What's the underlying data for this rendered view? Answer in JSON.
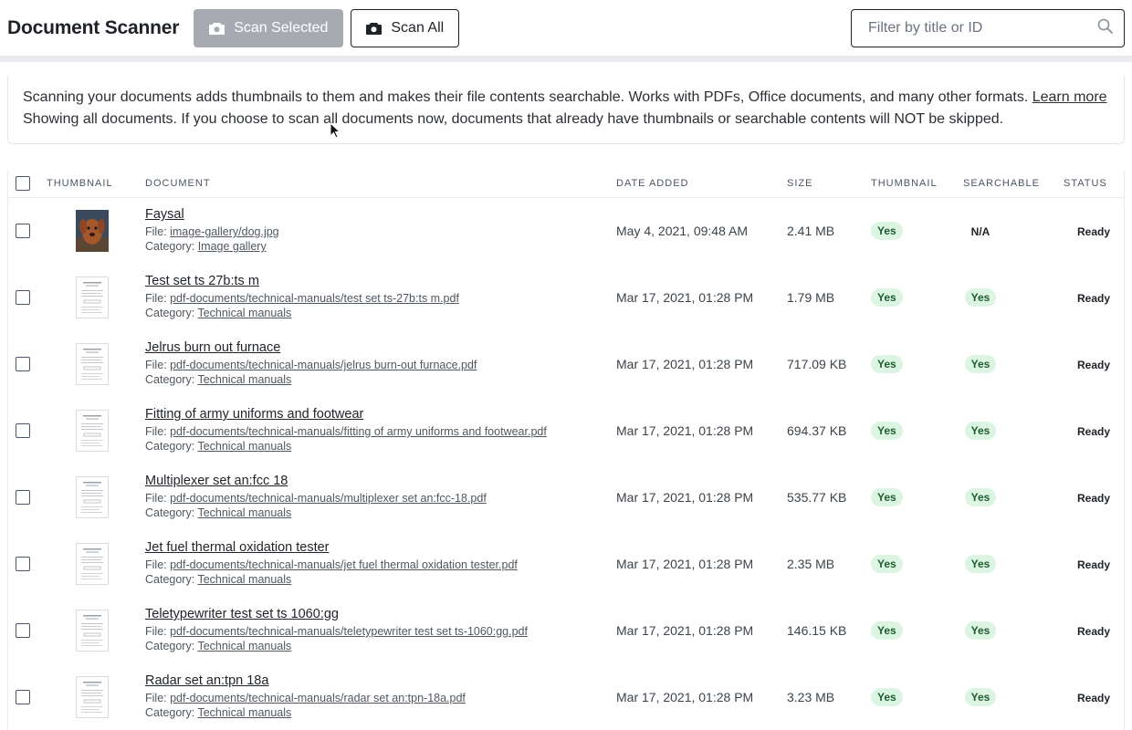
{
  "header": {
    "title": "Document Scanner",
    "scan_selected_label": "Scan Selected",
    "scan_all_label": "Scan All",
    "search_placeholder": "Filter by title or ID"
  },
  "info": {
    "line1": "Scanning your documents adds thumbnails to them and makes their file contents searchable. Works with PDFs, Office documents, and many other formats.",
    "learn_more": "Learn more",
    "line2": "Showing all documents. If you choose to scan all documents now, documents that already have thumbnails or searchable contents will NOT be skipped."
  },
  "table": {
    "columns": {
      "thumbnail": "THUMBNAIL",
      "document": "DOCUMENT",
      "date_added": "DATE ADDED",
      "size": "SIZE",
      "has_thumbnail": "THUMBNAIL",
      "searchable": "SEARCHABLE",
      "status": "STATUS"
    },
    "file_prefix": "File:",
    "category_prefix": "Category:",
    "rows": [
      {
        "title": "Faysal",
        "file": "image-gallery/dog.jpg",
        "category": "Image gallery",
        "date": "May 4, 2021, 09:48 AM",
        "size": "2.41 MB",
        "thumbnail": "Yes",
        "searchable": "N/A",
        "status": "Ready",
        "thumb_type": "photo"
      },
      {
        "title": "Test set ts 27b:ts m",
        "file": "pdf-documents/technical-manuals/test set ts-27b:ts m.pdf",
        "category": "Technical manuals",
        "date": "Mar 17, 2021, 01:28 PM",
        "size": "1.79 MB",
        "thumbnail": "Yes",
        "searchable": "Yes",
        "status": "Ready",
        "thumb_type": "doc"
      },
      {
        "title": "Jelrus burn out furnace",
        "file": "pdf-documents/technical-manuals/jelrus burn-out furnace.pdf",
        "category": "Technical manuals",
        "date": "Mar 17, 2021, 01:28 PM",
        "size": "717.09 KB",
        "thumbnail": "Yes",
        "searchable": "Yes",
        "status": "Ready",
        "thumb_type": "doc"
      },
      {
        "title": "Fitting of army uniforms and footwear",
        "file": "pdf-documents/technical-manuals/fitting of army uniforms and footwear.pdf",
        "category": "Technical manuals",
        "date": "Mar 17, 2021, 01:28 PM",
        "size": "694.37 KB",
        "thumbnail": "Yes",
        "searchable": "Yes",
        "status": "Ready",
        "thumb_type": "doc"
      },
      {
        "title": "Multiplexer set an:fcc 18",
        "file": "pdf-documents/technical-manuals/multiplexer set an:fcc-18.pdf",
        "category": "Technical manuals",
        "date": "Mar 17, 2021, 01:28 PM",
        "size": "535.77 KB",
        "thumbnail": "Yes",
        "searchable": "Yes",
        "status": "Ready",
        "thumb_type": "doc"
      },
      {
        "title": "Jet fuel thermal oxidation tester",
        "file": "pdf-documents/technical-manuals/jet fuel thermal oxidation tester.pdf",
        "category": "Technical manuals",
        "date": "Mar 17, 2021, 01:28 PM",
        "size": "2.35 MB",
        "thumbnail": "Yes",
        "searchable": "Yes",
        "status": "Ready",
        "thumb_type": "doc"
      },
      {
        "title": "Teletypewriter test set ts 1060:gg",
        "file": "pdf-documents/technical-manuals/teletypewriter test set ts-1060:gg.pdf",
        "category": "Technical manuals",
        "date": "Mar 17, 2021, 01:28 PM",
        "size": "146.15 KB",
        "thumbnail": "Yes",
        "searchable": "Yes",
        "status": "Ready",
        "thumb_type": "doc"
      },
      {
        "title": "Radar set an:tpn 18a",
        "file": "pdf-documents/technical-manuals/radar set an:tpn-18a.pdf",
        "category": "Technical manuals",
        "date": "Mar 17, 2021, 01:28 PM",
        "size": "3.23 MB",
        "thumbnail": "Yes",
        "searchable": "Yes",
        "status": "Ready",
        "thumb_type": "doc"
      }
    ]
  },
  "colors": {
    "pill_bg": "#dcf5e3",
    "pill_text": "#1d5d2f",
    "disabled_button": "#a7abb1"
  },
  "icons": {
    "camera": "camera-icon",
    "search": "search-icon"
  }
}
